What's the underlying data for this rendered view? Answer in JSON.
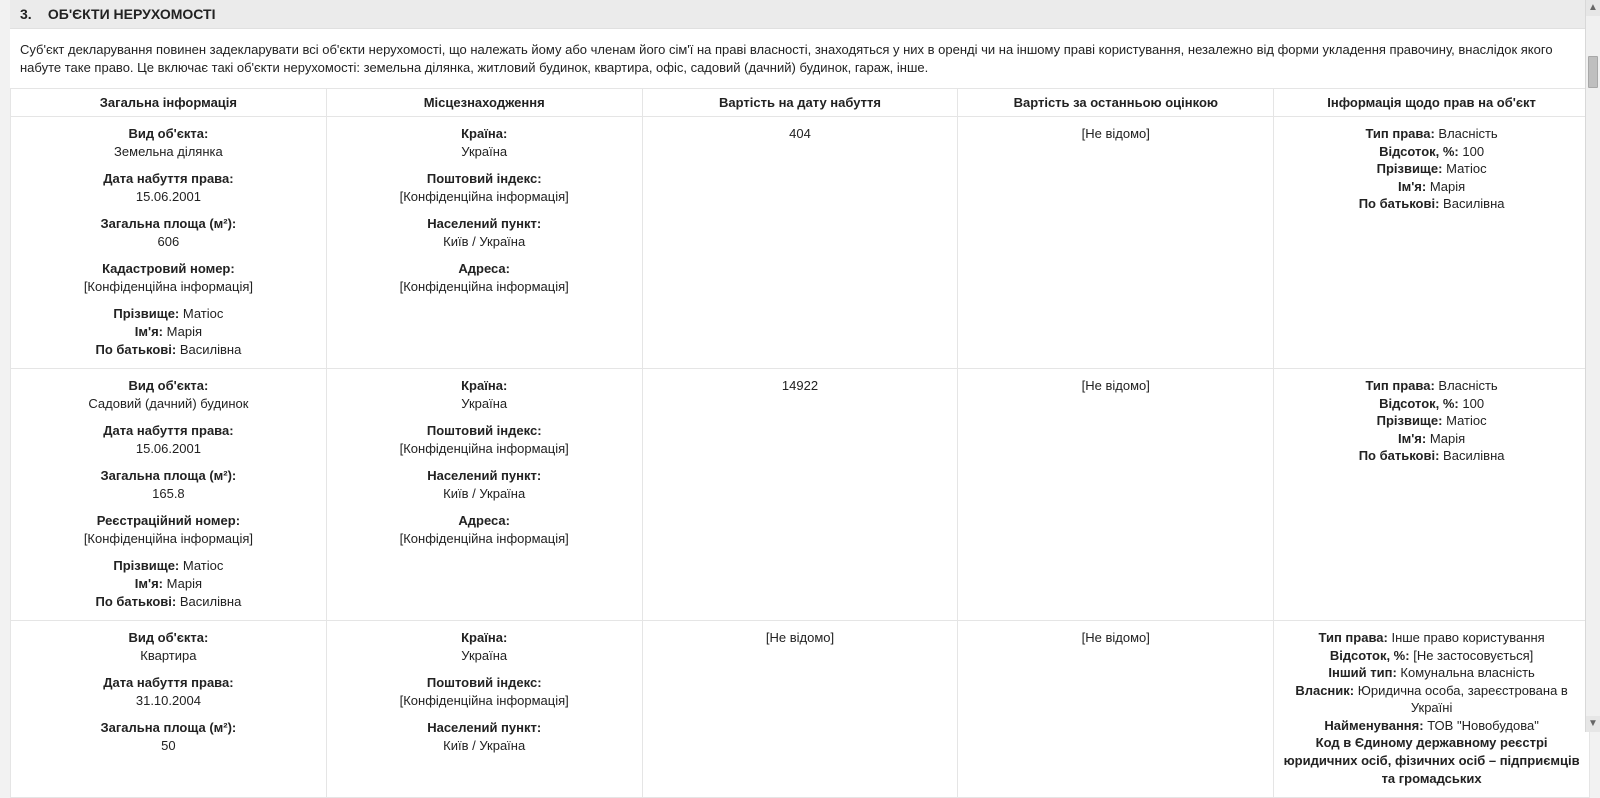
{
  "section": {
    "number": "3.",
    "title": "ОБ'ЄКТИ НЕРУХОМОСТІ",
    "intro": "Суб'єкт декларування повинен задекларувати всі об'єкти нерухомості, що належать йому або членам його сім'ї на праві власності, знаходяться у них в оренді чи на іншому праві користування, незалежно від форми укладення правочину, внаслідок якого набуте таке право. Це включає такі об'єкти нерухомості: земельна ділянка, житловий будинок, квартира, офіс, садовий (дачний) будинок, гараж, інше."
  },
  "headers": {
    "col1": "Загальна інформація",
    "col2": "Місцезнаходження",
    "col3": "Вартість на дату набуття",
    "col4": "Вартість за останньою оцінкою",
    "col5": "Інформація щодо прав на об'єкт"
  },
  "labels": {
    "objectType": "Вид об'єкта:",
    "acqDate": "Дата набуття права:",
    "totalArea": "Загальна площа (м²):",
    "cadastral": "Кадастровий номер:",
    "regNumber": "Реєстраційний номер:",
    "surname": "Прізвище:",
    "name": "Ім'я:",
    "patronymic": "По батькові:",
    "country": "Країна:",
    "postal": "Поштовий індекс:",
    "locality": "Населений пункт:",
    "address": "Адреса:",
    "rightType": "Тип права:",
    "percent": "Відсоток, %:",
    "otherType": "Інший тип:",
    "owner": "Власник:",
    "orgName": "Найменування:",
    "edr": "Код в Єдиному державному реєстрі юридичних осіб, фізичних осіб – підприємців та громадських"
  },
  "common": {
    "confidential": "[Конфіденційна інформація]",
    "unknown": "[Не відомо]",
    "notApplicable": "[Не застосовується]"
  },
  "rows": [
    {
      "objectType": "Земельна ділянка",
      "acqDate": "15.06.2001",
      "totalArea": "606",
      "idLabelKey": "cadastral",
      "idValue": "[Конфіденційна інформація]",
      "person": {
        "surname": "Матіос",
        "name": "Марія",
        "patronymic": "Василівна"
      },
      "loc": {
        "country": "Україна",
        "postal": "[Конфіденційна інформація]",
        "locality": "Київ / Україна",
        "address": "[Конфіденційна інформація]"
      },
      "costAcq": "404",
      "costLast": "[Не відомо]",
      "rights": {
        "mode": "own",
        "rightType": "Власність",
        "percent": "100",
        "surname": "Матіос",
        "name": "Марія",
        "patronymic": "Василівна"
      }
    },
    {
      "objectType": "Садовий (дачний) будинок",
      "acqDate": "15.06.2001",
      "totalArea": "165.8",
      "idLabelKey": "regNumber",
      "idValue": "[Конфіденційна інформація]",
      "person": {
        "surname": "Матіос",
        "name": "Марія",
        "patronymic": "Василівна"
      },
      "loc": {
        "country": "Україна",
        "postal": "[Конфіденційна інформація]",
        "locality": "Київ / Україна",
        "address": "[Конфіденційна інформація]"
      },
      "costAcq": "14922",
      "costLast": "[Не відомо]",
      "rights": {
        "mode": "own",
        "rightType": "Власність",
        "percent": "100",
        "surname": "Матіос",
        "name": "Марія",
        "patronymic": "Василівна"
      }
    },
    {
      "objectType": "Квартира",
      "acqDate": "31.10.2004",
      "totalArea": "50",
      "idLabelKey": "",
      "idValue": "",
      "person": null,
      "loc": {
        "country": "Україна",
        "postal": "[Конфіденційна інформація]",
        "locality": "Київ / Україна",
        "address": ""
      },
      "costAcq": "[Не відомо]",
      "costLast": "[Не відомо]",
      "rights": {
        "mode": "other",
        "rightType": "Інше право користування",
        "percent": "[Не застосовується]",
        "otherType": "Комунальна власність",
        "owner": "Юридична особа, зареєстрована в Україні",
        "orgName": "ТОВ \"Новобудова\""
      }
    }
  ]
}
